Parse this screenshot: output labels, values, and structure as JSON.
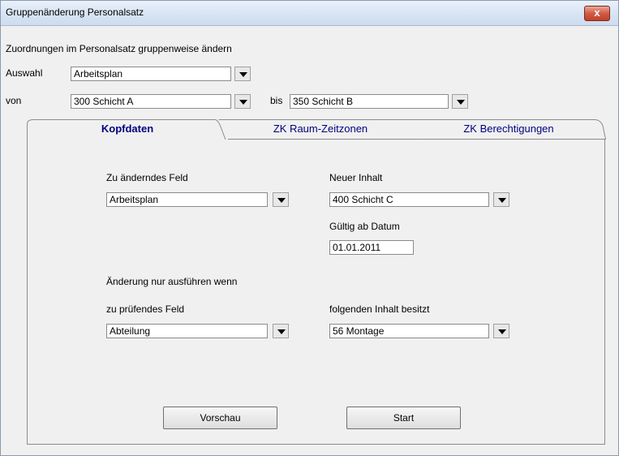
{
  "window": {
    "title": "Gruppenänderung Personalsatz",
    "close_label": "x"
  },
  "header": {
    "description": "Zuordnungen im Personalsatz gruppenweise ändern",
    "auswahl_label": "Auswahl",
    "auswahl_value": "Arbeitsplan",
    "von_label": "von",
    "von_value": "300  Schicht A",
    "bis_label": "bis",
    "bis_value": "350  Schicht B"
  },
  "tabs": [
    {
      "label": "Kopfdaten",
      "active": true
    },
    {
      "label": "ZK Raum-Zeitzonen",
      "active": false
    },
    {
      "label": "ZK Berechtigungen",
      "active": false
    }
  ],
  "form": {
    "field_label": "Zu änderndes Feld",
    "field_value": "Arbeitsplan",
    "new_content_label": "Neuer Inhalt",
    "new_content_value": "400 Schicht C",
    "valid_from_label": "Gültig ab Datum",
    "valid_from_value": "01.01.2011",
    "condition_heading": "Änderung nur ausführen wenn",
    "check_field_label": "zu prüfendes Feld",
    "check_field_value": "Abteilung",
    "check_content_label": "folgenden Inhalt besitzt",
    "check_content_value": "56 Montage"
  },
  "buttons": {
    "preview_label": "Vorschau",
    "start_label": "Start"
  }
}
